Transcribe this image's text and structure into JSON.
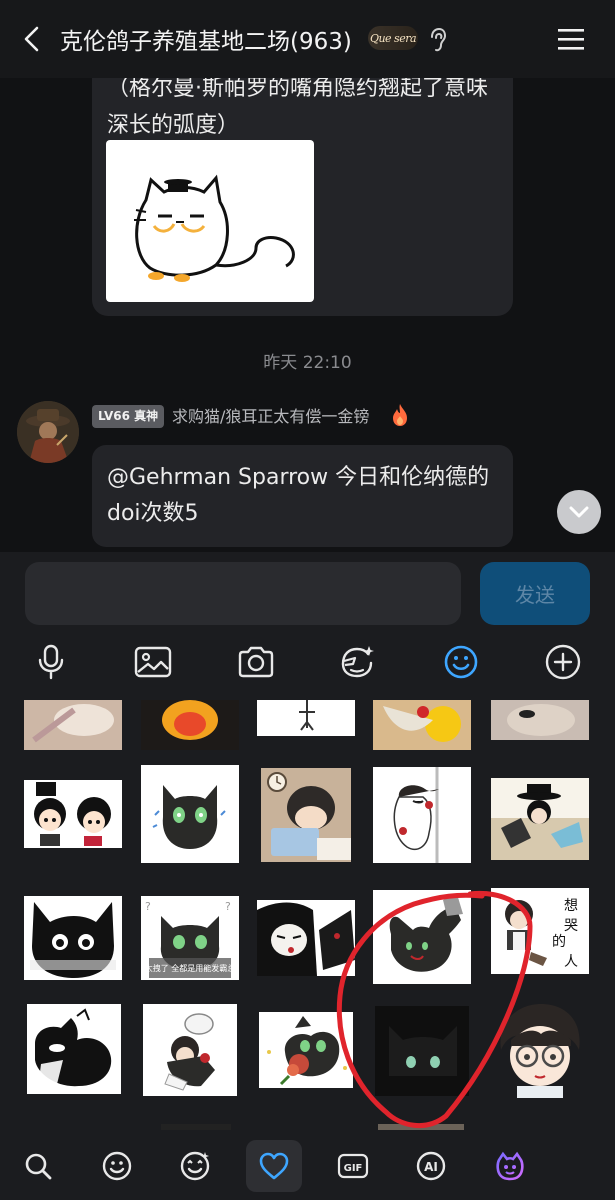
{
  "header": {
    "title": "克伦鸽子养殖基地二场(963)",
    "logo_text": "Que sera"
  },
  "chat": {
    "message1_text": "（格尔曼·斯帕罗的嘴角隐约翘起了意味深长的弧度）",
    "timestamp": "昨天 22:10",
    "sender": {
      "level": "LV66 真神",
      "name": "求购猫/狼耳正太有偿一金镑"
    },
    "message2_text": "@Gehrman Sparrow 今日和伦纳德的doi次数5"
  },
  "input": {
    "value": "",
    "send_label": "发送"
  },
  "toolbar": {
    "icons": [
      "microphone-icon",
      "image-icon",
      "camera-icon",
      "sticker-face-icon",
      "emoji-icon",
      "plus-icon"
    ],
    "active": "emoji-icon",
    "active_color": "#3ea6ff"
  },
  "sticker_panel": {
    "tabs": [
      "search-icon",
      "emoji-icon",
      "magic-emoji-icon",
      "favorites-heart-icon",
      "gif-icon",
      "ai-icon",
      "creature-icon"
    ],
    "active_tab": "favorites-heart-icon",
    "sticker_texts": {
      "r3c2": "太拽了 全都是用能发霸总",
      "r3c5": "想哭的人"
    },
    "highlight_color": "#e0242c"
  }
}
